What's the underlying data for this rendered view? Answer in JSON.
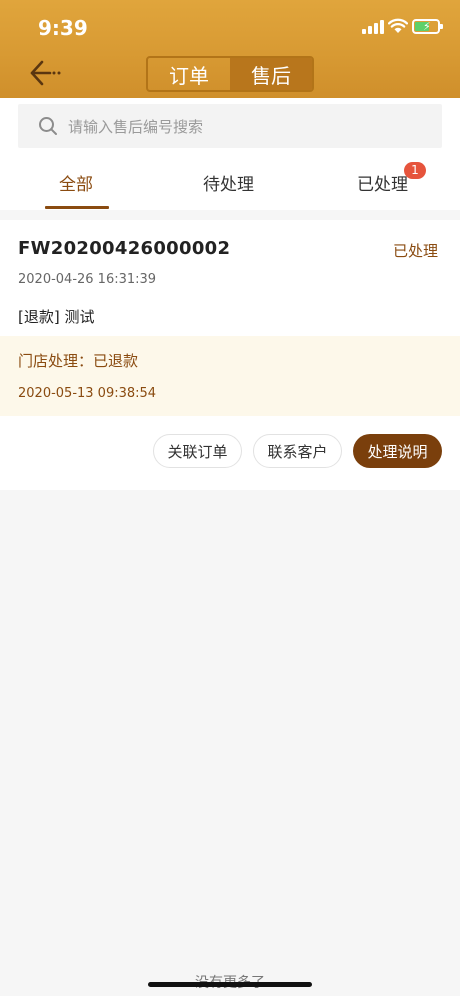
{
  "status_bar": {
    "time": "9:39"
  },
  "header": {
    "segments": [
      {
        "label": "订单",
        "active": false
      },
      {
        "label": "售后",
        "active": true
      }
    ]
  },
  "search": {
    "placeholder": "请输入售后编号搜索"
  },
  "tabs": [
    {
      "label": "全部",
      "active": true
    },
    {
      "label": "待处理",
      "active": false
    },
    {
      "label": "已处理",
      "active": false,
      "badge": "1"
    }
  ],
  "orders": [
    {
      "order_no": "FW20200426000002",
      "status": "已处理",
      "time": "2020-04-26 16:31:39",
      "desc": "[退款] 测试",
      "store_result": "门店处理：已退款",
      "store_time": "2020-05-13 09:38:54",
      "actions": [
        "关联订单",
        "联系客户",
        "处理说明"
      ]
    }
  ],
  "footer": {
    "no_more": "没有更多了"
  },
  "colors": {
    "header": "#d89a33",
    "accent": "#8a4b10",
    "primary_button": "#7a3f0c",
    "badge": "#e6543c"
  }
}
